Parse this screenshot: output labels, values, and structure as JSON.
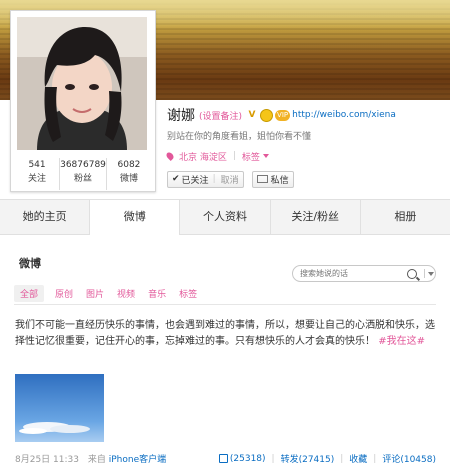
{
  "profile": {
    "name": "谢娜",
    "remark_label": "(设置备注)",
    "vip_label": "VIP",
    "url": "http://weibo.com/xiena",
    "bio": "别站在你的角度看姐，姐怕你看不懂",
    "location": "北京 海淀区",
    "tag_label": "标签",
    "followed_label": "已关注",
    "cancel_label": "取消",
    "message_label": "私信",
    "stats": [
      {
        "value": "541",
        "label": "关注"
      },
      {
        "value": "36876789",
        "label": "粉丝"
      },
      {
        "value": "6082",
        "label": "微博"
      }
    ]
  },
  "nav": {
    "tabs": [
      {
        "label": "她的主页"
      },
      {
        "label": "微博"
      },
      {
        "label": "个人资料"
      },
      {
        "label": "关注/粉丝"
      },
      {
        "label": "相册"
      }
    ]
  },
  "feed": {
    "section_title": "微博",
    "search_placeholder": "搜索她说的话",
    "filters": [
      "全部",
      "原创",
      "图片",
      "视频",
      "音乐",
      "标签"
    ],
    "post": {
      "text": "我们不可能一直经历快乐的事情，也会遇到难过的事情，所以，想要让自己的心洒脱和快乐，选择性记忆很重要，记住开心的事，忘掉难过的事。只有想快乐的人才会真的快乐！",
      "hashtag": "#我在这#",
      "time": "8月25日 11:33",
      "source_prefix": "来自",
      "source": "iPhone客户端",
      "likes": "(25318)",
      "repost": "转发(27415)",
      "favorite": "收藏",
      "comment": "评论(10458)"
    }
  },
  "colors": {
    "accent_pink": "#e2589a",
    "link_blue": "#0a6dc2"
  }
}
